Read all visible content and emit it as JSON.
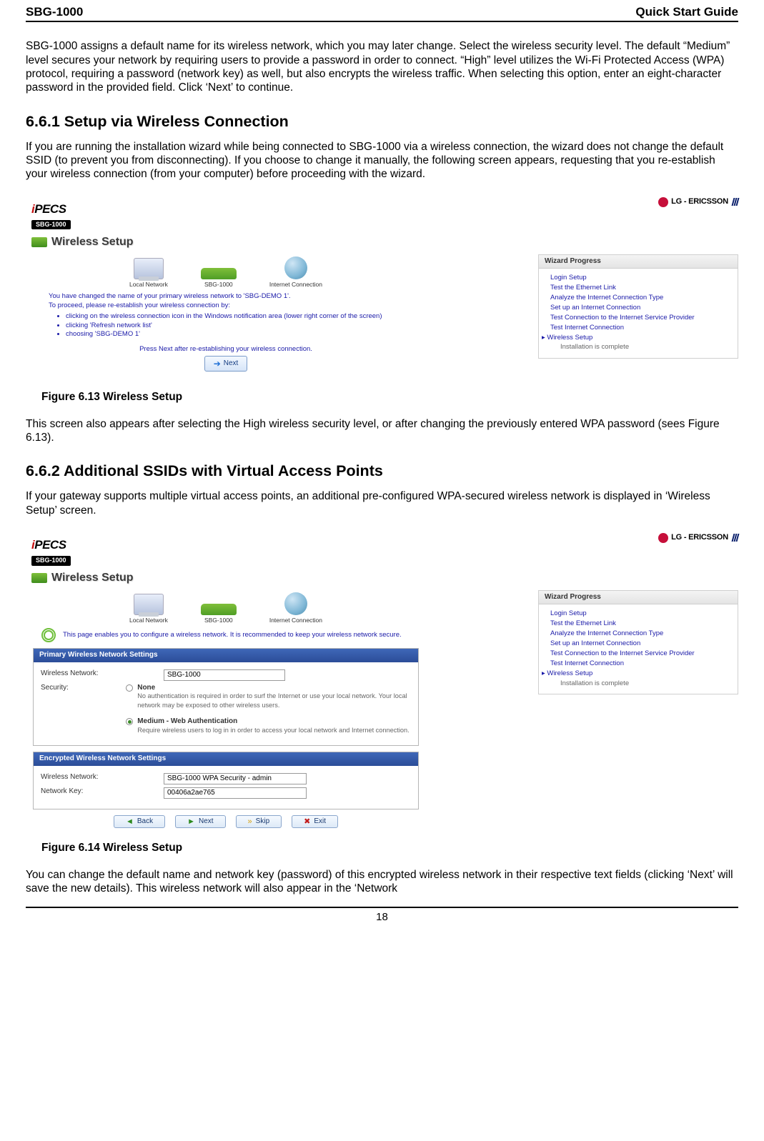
{
  "header": {
    "left": "SBG-1000",
    "right": "Quick Start Guide"
  },
  "intro_para": "SBG-1000 assigns a default name for its wireless network, which you may later change. Select the wireless security level. The default “Medium” level secures your network by requiring users to provide a password in order to connect. “High” level utilizes the Wi-Fi Protected Access (WPA) protocol, requiring a password (network key) as well, but also encrypts the wireless traffic. When selecting this option, enter an eight-character password in the provided field. Click ‘Next’ to continue.",
  "section1": {
    "heading": "6.6.1 Setup via Wireless Connection",
    "para": "If you are running the installation wizard while being connected to SBG-1000 via a wireless connection, the wizard does not change the default SSID (to prevent you from disconnecting). If you choose to change it manually, the following screen appears, requesting that you re-establish your wireless connection (from your computer) before proceeding with the wizard."
  },
  "brand": {
    "ipecs_prefix": "i",
    "ipecs_rest": "PECS",
    "sbg_badge": "SBG-1000",
    "lg_text": "LG - ERICSSON",
    "wireless_setup_title": "Wireless Setup"
  },
  "topology": {
    "local": "Local Network",
    "sbg": "SBG-1000",
    "internet": "Internet Connection"
  },
  "fig1_help": {
    "line1": "You have changed the name of your primary wireless network to 'SBG-DEMO 1'.",
    "line2": "To proceed, please re-establish your wireless connection by:",
    "bullets": [
      "clicking on the wireless connection icon in the Windows notification area (lower right corner of the screen)",
      "clicking 'Refresh network list'",
      "choosing 'SBG-DEMO 1'"
    ],
    "press": "Press Next after re-establishing your wireless connection.",
    "next_label": "Next"
  },
  "wizard": {
    "title": "Wizard Progress",
    "items": [
      "Login Setup",
      "Test the Ethernet Link",
      "Analyze the Internet Connection Type",
      "Set up an Internet Connection",
      "Test Connection to the Internet Service Provider",
      "Test Internet Connection"
    ],
    "current": "Wireless Setup",
    "sub": "Installation is complete"
  },
  "fig1_caption": "Figure 6.13 Wireless Setup",
  "mid_para": "This screen also appears after selecting the High wireless security level, or after changing the previously entered WPA password (sees Figure 6.13).",
  "section2": {
    "heading": "6.6.2 Additional SSIDs with Virtual Access Points",
    "para": "If your gateway supports multiple virtual access points, an additional pre-configured WPA-secured wireless network is displayed in ‘Wireless Setup’ screen."
  },
  "fig2": {
    "desc": "This page enables you to configure a wireless network. It is recommended to keep your wireless network secure.",
    "primary_head": "Primary Wireless Network Settings",
    "lbl_wireless_network": "Wireless Network:",
    "val_wireless_network": "SBG-1000",
    "lbl_security": "Security:",
    "radio_none_title": "None",
    "radio_none_desc": "No authentication is required in order to surf the Internet or use your local network. Your local network may be exposed to other wireless users.",
    "radio_medium_title": "Medium - Web Authentication",
    "radio_medium_desc": "Require wireless users to log in in order to access your local network and Internet connection.",
    "encrypted_head": "Encrypted Wireless Network Settings",
    "enc_network_val": "SBG-1000 WPA Security - admin",
    "lbl_network_key": "Network Key:",
    "network_key_val": "00406a2ae765",
    "buttons": {
      "back": "Back",
      "next": "Next",
      "skip": "Skip",
      "exit": "Exit"
    }
  },
  "fig2_caption": "Figure 6.14 Wireless Setup",
  "closing_para": "You can change the default name and network key (password) of this encrypted wireless network in their respective text fields (clicking ‘Next’ will save the new details). This wireless network will also appear in the ‘Network",
  "page_number": "18"
}
